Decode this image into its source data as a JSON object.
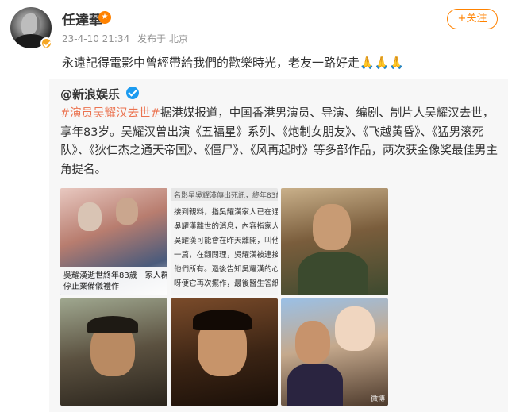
{
  "post": {
    "author": "任達華",
    "date": "23-4-10 21:34",
    "source": "发布于 北京",
    "follow_label": "+关注",
    "text": "永遠記得電影中曾經帶給我們的歡樂時光，老友一路好走",
    "emoji": "🙏🙏🙏"
  },
  "repost": {
    "author": "@新浪娱乐",
    "hashtag": "#演员吴耀汉去世#",
    "body": "据港媒报道，中国香港男演员、导演、编剧、制片人吴耀汉去世，享年83岁。吴耀汉曾出演《五福星》系列、《炮制女朋友》、《飞越黄昏》、《猛男滚死队》、《狄仁杰之通天帝国》、《僵尸》、《风再起时》等多部作品，两次获金像奖最佳男主角提名。",
    "images": [
      {
        "caption_line1": "吳耀漢逝世終年83歲　家人群",
        "caption_line2": "停止業備儀禮作"
      },
      {
        "title": "名影星吳耀漢傳出死訊，終年83歲。",
        "lines": [
          "接到親料，指吳耀漢家人已在通",
          "吳耀漢離世的消息，內容指家人們接",
          "吳耀漢可能會在昨天離開，叫他們",
          "一篇，在翻閱理，吳耀漢被連接許到",
          "他們所有。過後告知吳耀漢的心願停",
          "呀便它再次擺作，最後醫生答紙確認"
        ]
      },
      {},
      {},
      {},
      {
        "watermark": "微博"
      }
    ]
  },
  "icons": {
    "avatar_badge": "verified-badge-icon",
    "vip": "vip-icon",
    "repost_badge": "blue-verified-icon"
  },
  "colors": {
    "accent": "#ff8200",
    "hashtag": "#eb7350",
    "verified_blue": "#1c9bf0"
  }
}
